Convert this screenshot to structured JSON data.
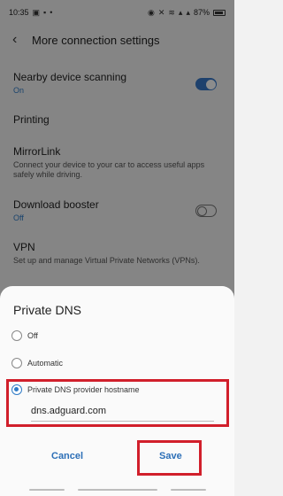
{
  "status_bar": {
    "time": "10:35",
    "battery_percent": "87%",
    "left_icons": [
      "gallery-icon",
      "message-icon",
      "dot-icon"
    ],
    "right_icons": [
      "alarm-icon",
      "mute-icon",
      "wifi-icon",
      "signal-icon",
      "signal-icon"
    ]
  },
  "header": {
    "title": "More connection settings"
  },
  "settings": {
    "nearby": {
      "title": "Nearby device scanning",
      "status": "On",
      "enabled": true
    },
    "printing": {
      "title": "Printing"
    },
    "mirrorlink": {
      "title": "MirrorLink",
      "description": "Connect your device to your car to access useful apps safely while driving."
    },
    "download_booster": {
      "title": "Download booster",
      "status": "Off",
      "enabled": false
    },
    "vpn": {
      "title": "VPN",
      "description": "Set up and manage Virtual Private Networks (VPNs)."
    }
  },
  "dialog": {
    "title": "Private DNS",
    "options": [
      {
        "label": "Off",
        "selected": false
      },
      {
        "label": "Automatic",
        "selected": false
      },
      {
        "label": "Private DNS provider hostname",
        "selected": true
      }
    ],
    "hostname_value": "dns.adguard.com",
    "cancel_label": "Cancel",
    "save_label": "Save",
    "highlight_color": "#d11f2b",
    "accent_color": "#2f7bc6"
  }
}
